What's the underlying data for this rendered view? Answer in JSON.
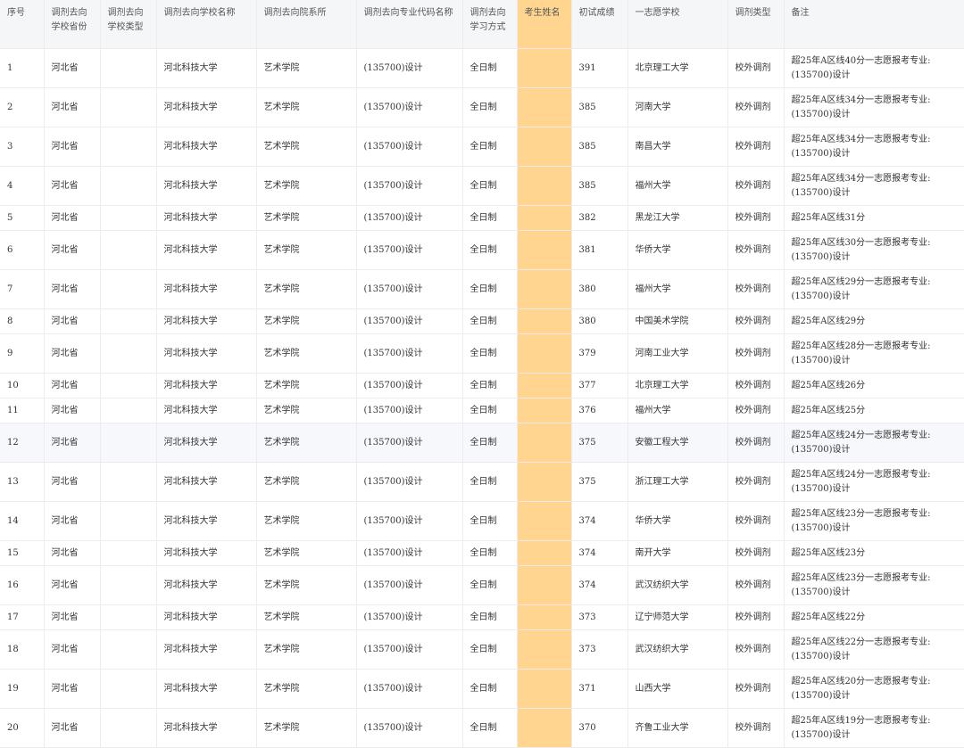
{
  "columns": [
    "序号",
    "调剂去向学校省份",
    "调剂去向学校类型",
    "调剂去向学校名称",
    "调剂去向院系所",
    "调剂去向专业代码名称",
    "调剂去向学习方式",
    "考生姓名",
    "初试成绩",
    "一志愿学校",
    "调剂类型",
    "备注"
  ],
  "columns_display": [
    "序号",
    "调剂去向\n学校省份",
    "调剂去向\n学校类型",
    "调剂去向学校名称",
    "调剂去向院系所",
    "调剂去向专业代码名称",
    "调剂去向\n学习方式",
    "考生姓名",
    "初试成绩",
    "一志愿学校",
    "调剂类型",
    "备注"
  ],
  "rows": [
    {
      "no": "1",
      "prov": "河北省",
      "type": "",
      "school": "河北科技大学",
      "dept": "艺术学院",
      "major": "(135700)设计",
      "mode": "全日制",
      "name": "",
      "score": "391",
      "first": "北京理工大学",
      "adj": "校外调剂",
      "note": "超25年A区线40分一志愿报考专业:(135700)设计"
    },
    {
      "no": "2",
      "prov": "河北省",
      "type": "",
      "school": "河北科技大学",
      "dept": "艺术学院",
      "major": "(135700)设计",
      "mode": "全日制",
      "name": "",
      "score": "385",
      "first": "河南大学",
      "adj": "校外调剂",
      "note": "超25年A区线34分一志愿报考专业:(135700)设计"
    },
    {
      "no": "3",
      "prov": "河北省",
      "type": "",
      "school": "河北科技大学",
      "dept": "艺术学院",
      "major": "(135700)设计",
      "mode": "全日制",
      "name": "",
      "score": "385",
      "first": "南昌大学",
      "adj": "校外调剂",
      "note": "超25年A区线34分一志愿报考专业:(135700)设计"
    },
    {
      "no": "4",
      "prov": "河北省",
      "type": "",
      "school": "河北科技大学",
      "dept": "艺术学院",
      "major": "(135700)设计",
      "mode": "全日制",
      "name": "",
      "score": "385",
      "first": "福州大学",
      "adj": "校外调剂",
      "note": "超25年A区线34分一志愿报考专业:(135700)设计"
    },
    {
      "no": "5",
      "prov": "河北省",
      "type": "",
      "school": "河北科技大学",
      "dept": "艺术学院",
      "major": "(135700)设计",
      "mode": "全日制",
      "name": "",
      "score": "382",
      "first": "黑龙江大学",
      "adj": "校外调剂",
      "note": "超25年A区线31分"
    },
    {
      "no": "6",
      "prov": "河北省",
      "type": "",
      "school": "河北科技大学",
      "dept": "艺术学院",
      "major": "(135700)设计",
      "mode": "全日制",
      "name": "",
      "score": "381",
      "first": "华侨大学",
      "adj": "校外调剂",
      "note": "超25年A区线30分一志愿报考专业:(135700)设计"
    },
    {
      "no": "7",
      "prov": "河北省",
      "type": "",
      "school": "河北科技大学",
      "dept": "艺术学院",
      "major": "(135700)设计",
      "mode": "全日制",
      "name": "",
      "score": "380",
      "first": "福州大学",
      "adj": "校外调剂",
      "note": "超25年A区线29分一志愿报考专业:(135700)设计"
    },
    {
      "no": "8",
      "prov": "河北省",
      "type": "",
      "school": "河北科技大学",
      "dept": "艺术学院",
      "major": "(135700)设计",
      "mode": "全日制",
      "name": "",
      "score": "380",
      "first": "中国美术学院",
      "adj": "校外调剂",
      "note": "超25年A区线29分"
    },
    {
      "no": "9",
      "prov": "河北省",
      "type": "",
      "school": "河北科技大学",
      "dept": "艺术学院",
      "major": "(135700)设计",
      "mode": "全日制",
      "name": "",
      "score": "379",
      "first": "河南工业大学",
      "adj": "校外调剂",
      "note": "超25年A区线28分一志愿报考专业:(135700)设计"
    },
    {
      "no": "10",
      "prov": "河北省",
      "type": "",
      "school": "河北科技大学",
      "dept": "艺术学院",
      "major": "(135700)设计",
      "mode": "全日制",
      "name": "",
      "score": "377",
      "first": "北京理工大学",
      "adj": "校外调剂",
      "note": "超25年A区线26分"
    },
    {
      "no": "11",
      "prov": "河北省",
      "type": "",
      "school": "河北科技大学",
      "dept": "艺术学院",
      "major": "(135700)设计",
      "mode": "全日制",
      "name": "",
      "score": "376",
      "first": "福州大学",
      "adj": "校外调剂",
      "note": "超25年A区线25分"
    },
    {
      "no": "12",
      "prov": "河北省",
      "type": "",
      "school": "河北科技大学",
      "dept": "艺术学院",
      "major": "(135700)设计",
      "mode": "全日制",
      "name": "",
      "score": "375",
      "first": "安徽工程大学",
      "adj": "校外调剂",
      "note": "超25年A区线24分一志愿报考专业:(135700)设计"
    },
    {
      "no": "13",
      "prov": "河北省",
      "type": "",
      "school": "河北科技大学",
      "dept": "艺术学院",
      "major": "(135700)设计",
      "mode": "全日制",
      "name": "",
      "score": "375",
      "first": "浙江理工大学",
      "adj": "校外调剂",
      "note": "超25年A区线24分一志愿报考专业:(135700)设计"
    },
    {
      "no": "14",
      "prov": "河北省",
      "type": "",
      "school": "河北科技大学",
      "dept": "艺术学院",
      "major": "(135700)设计",
      "mode": "全日制",
      "name": "",
      "score": "374",
      "first": "华侨大学",
      "adj": "校外调剂",
      "note": "超25年A区线23分一志愿报考专业:(135700)设计"
    },
    {
      "no": "15",
      "prov": "河北省",
      "type": "",
      "school": "河北科技大学",
      "dept": "艺术学院",
      "major": "(135700)设计",
      "mode": "全日制",
      "name": "",
      "score": "374",
      "first": "南开大学",
      "adj": "校外调剂",
      "note": "超25年A区线23分"
    },
    {
      "no": "16",
      "prov": "河北省",
      "type": "",
      "school": "河北科技大学",
      "dept": "艺术学院",
      "major": "(135700)设计",
      "mode": "全日制",
      "name": "",
      "score": "374",
      "first": "武汉纺织大学",
      "adj": "校外调剂",
      "note": "超25年A区线23分一志愿报考专业:(135700)设计"
    },
    {
      "no": "17",
      "prov": "河北省",
      "type": "",
      "school": "河北科技大学",
      "dept": "艺术学院",
      "major": "(135700)设计",
      "mode": "全日制",
      "name": "",
      "score": "373",
      "first": "辽宁师范大学",
      "adj": "校外调剂",
      "note": "超25年A区线22分"
    },
    {
      "no": "18",
      "prov": "河北省",
      "type": "",
      "school": "河北科技大学",
      "dept": "艺术学院",
      "major": "(135700)设计",
      "mode": "全日制",
      "name": "",
      "score": "373",
      "first": "武汉纺织大学",
      "adj": "校外调剂",
      "note": "超25年A区线22分一志愿报考专业:(135700)设计"
    },
    {
      "no": "19",
      "prov": "河北省",
      "type": "",
      "school": "河北科技大学",
      "dept": "艺术学院",
      "major": "(135700)设计",
      "mode": "全日制",
      "name": "",
      "score": "371",
      "first": "山西大学",
      "adj": "校外调剂",
      "note": "超25年A区线20分一志愿报考专业:(135700)设计"
    },
    {
      "no": "20",
      "prov": "河北省",
      "type": "",
      "school": "河北科技大学",
      "dept": "艺术学院",
      "major": "(135700)设计",
      "mode": "全日制",
      "name": "",
      "score": "370",
      "first": "齐鲁工业大学",
      "adj": "校外调剂",
      "note": "超25年A区线19分一志愿报考专业:(135700)设计"
    }
  ],
  "colors": {
    "header_bg": "#f5f6f8",
    "masked_column": "#ffd590",
    "alt_row": "#f6f8fc",
    "border": "#ececec"
  }
}
